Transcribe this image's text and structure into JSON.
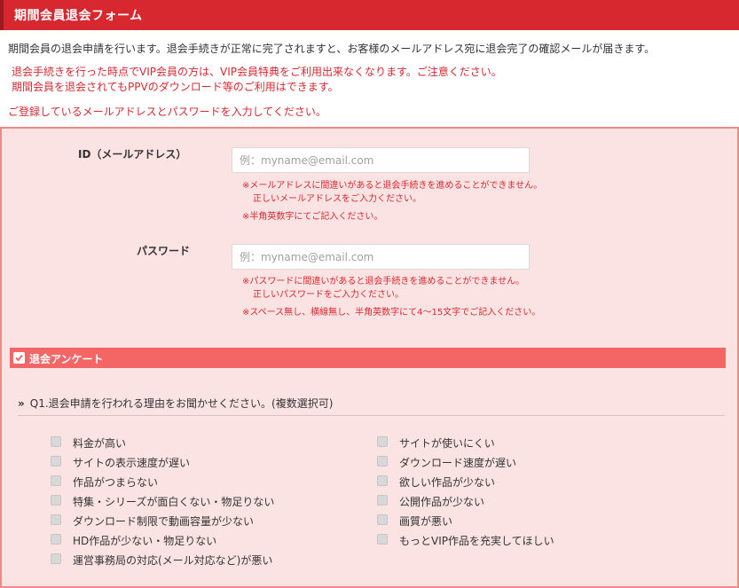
{
  "header": {
    "title": "期間会員退会フォーム"
  },
  "intro": "期間会員の退会申請を行います。退会手続きが正常に完了されますと、お客様のメールアドレス宛に退会完了の確認メールが届きます。",
  "notice": {
    "line1": "退会手続きを行った時点でVIP会員の方は、VIP会員特典をご利用出来なくなります。ご注意ください。",
    "line2": "期間会員を退会されてもPPVのダウンロード等のご利用はできます。"
  },
  "instruction": "ご登録しているメールアドレスとパスワードを入力してください。",
  "form": {
    "id_field": {
      "label": "ID（メールアドレス）",
      "placeholder": "例：myname@email.com",
      "value": "",
      "note1": "※メールアドレスに間違いがあると退会手続きを進めることができません。",
      "note1b": "正しいメールアドレスをご入力ください。",
      "note2": "※半角英数字にてご記入ください。"
    },
    "password_field": {
      "label": "パスワード",
      "placeholder": "例：myname@email.com",
      "value": "",
      "note1": "※パスワードに間違いがあると退会手続きを進めることができません。",
      "note1b": "正しいパスワードをご入力ください。",
      "note2": "※スペース無し、横線無し、半角英数字にて4～15文字でご記入ください。"
    }
  },
  "survey": {
    "title": "退会アンケート",
    "q1": {
      "chevron": "»",
      "label": "Q1.退会申請を行われる理由をお聞かせください。(複数選択可)",
      "left_options": [
        {
          "label": "料金が高い",
          "checked": false
        },
        {
          "label": "サイトの表示速度が遅い",
          "checked": false
        },
        {
          "label": "作品がつまらない",
          "checked": false
        },
        {
          "label": "特集・シリーズが面白くない・物足りない",
          "checked": false
        },
        {
          "label": "ダウンロード制限で動画容量が少ない",
          "checked": false
        },
        {
          "label": "HD作品が少ない・物足りない",
          "checked": false
        },
        {
          "label": "運営事務局の対応(メール対応など)が悪い",
          "checked": false
        }
      ],
      "right_options": [
        {
          "label": "サイトが使いにくい",
          "checked": false
        },
        {
          "label": "ダウンロード速度が遅い",
          "checked": false
        },
        {
          "label": "欲しい作品が少ない",
          "checked": false
        },
        {
          "label": "公開作品が少ない",
          "checked": false
        },
        {
          "label": "画質が悪い",
          "checked": false
        },
        {
          "label": "もっとVIP作品を充実してほしい",
          "checked": false
        }
      ]
    }
  },
  "colors": {
    "header_bg": "#d7282f",
    "accent_red": "#d7282f",
    "panel_bg": "#fbe3e3",
    "panel_border": "#f08a8a",
    "survey_bar": "#f26666"
  }
}
